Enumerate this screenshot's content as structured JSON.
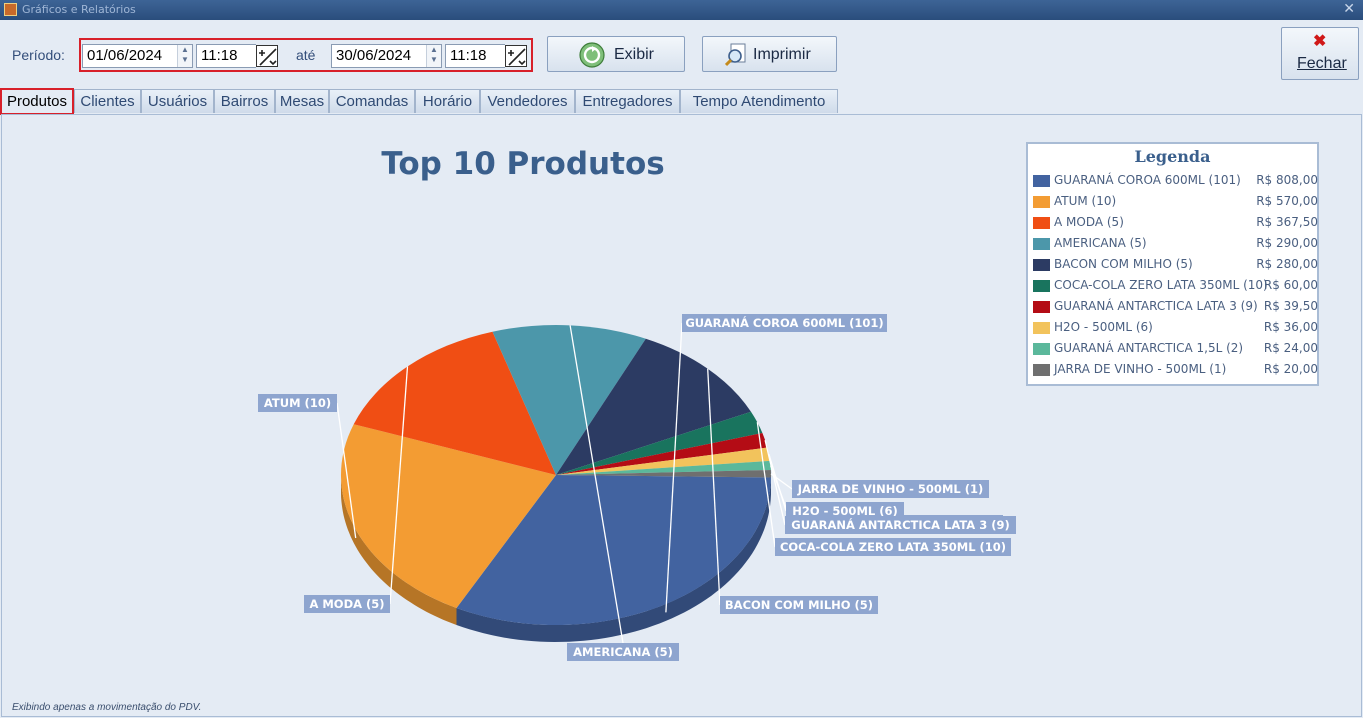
{
  "window": {
    "title": "Gráficos e Relatórios"
  },
  "toolbar": {
    "periodo_label": "Período:",
    "start_date": "01/06/2024",
    "start_time": "11:18",
    "ate_label": "até",
    "end_date": "30/06/2024",
    "end_time": "11:18",
    "exibir_label": "Exibir",
    "imprimir_label": "Imprimir",
    "fechar_label": "Fechar"
  },
  "tabs": [
    {
      "label": "Produtos",
      "active": true
    },
    {
      "label": "Clientes"
    },
    {
      "label": "Usuários"
    },
    {
      "label": "Bairros"
    },
    {
      "label": "Mesas"
    },
    {
      "label": "Comandas"
    },
    {
      "label": "Horário"
    },
    {
      "label": "Vendedores"
    },
    {
      "label": "Entregadores"
    },
    {
      "label": "Tempo Atendimento"
    }
  ],
  "chart_data": {
    "type": "pie",
    "title": "Top 10 Produtos",
    "legend_title": "Legenda",
    "legend_position": "top-right",
    "slices": [
      {
        "name": "GUARANÁ COROA 600ML (101)",
        "value": 808.0,
        "value_label": "R$ 808,00",
        "color": "#4263a0"
      },
      {
        "name": "ATUM (10)",
        "value": 570.0,
        "value_label": "R$ 570,00",
        "color": "#f39c33"
      },
      {
        "name": "A MODA (5)",
        "value": 367.5,
        "value_label": "R$ 367,50",
        "color": "#f04e14"
      },
      {
        "name": "AMERICANA (5)",
        "value": 290.0,
        "value_label": "R$ 290,00",
        "color": "#4c97aa"
      },
      {
        "name": "BACON COM MILHO (5)",
        "value": 280.0,
        "value_label": "R$ 280,00",
        "color": "#2c3b63"
      },
      {
        "name": "COCA-COLA ZERO LATA 350ML (10)",
        "value": 60.0,
        "value_label": "R$ 60,00",
        "color": "#19745e"
      },
      {
        "name": "GUARANÁ ANTARCTICA LATA 3 (9)",
        "value": 39.5,
        "value_label": "R$ 39,50",
        "color": "#b40c15"
      },
      {
        "name": "H2O - 500ML (6)",
        "value": 36.0,
        "value_label": "R$ 36,00",
        "color": "#f2c35c"
      },
      {
        "name": "GUARANÁ ANTARCTICA 1,5L (2)",
        "value": 24.0,
        "value_label": "R$ 24,00",
        "color": "#5bb89b"
      },
      {
        "name": "JARRA DE VINHO - 500ML (1)",
        "value": 20.0,
        "value_label": "R$ 20,00",
        "color": "#6f6f6f"
      }
    ]
  },
  "footnote": "Exibindo apenas a movimentação do PDV.",
  "icons": {
    "close": "close-x-icon",
    "exibir": "refresh-icon",
    "imprimir": "print-preview-icon",
    "fechar": "red-x-icon",
    "time_picker": "clock-arrows-icon"
  }
}
